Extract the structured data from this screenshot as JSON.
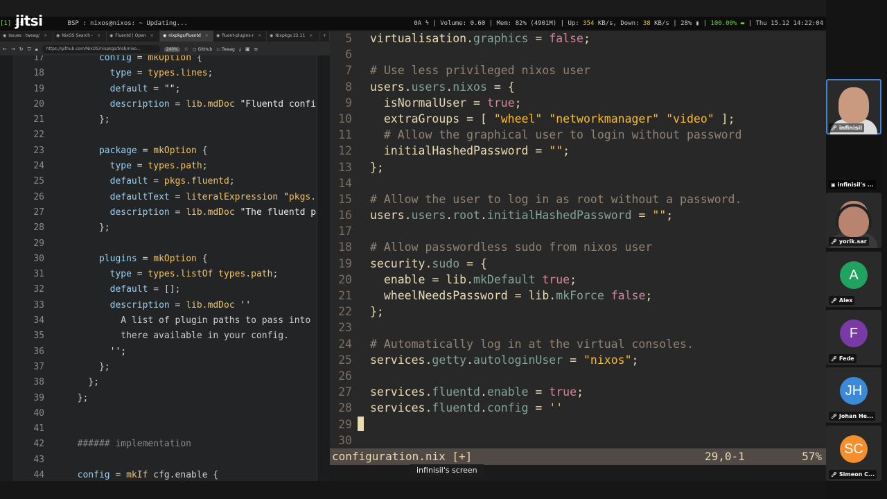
{
  "statusbar": {
    "workspace": "[1] 2:",
    "title": "BSP : nixos@nixos: ~ Updating...",
    "sys_prefix": "0A ϟ | Volume: 0.60 | Mem: 82% (4901M) | Up:",
    "up": "354",
    "sys_mid1": "KB/s, Down:",
    "down": "38",
    "sys_mid2": "KB/s | 28% ▮ |",
    "battery": "100.00%",
    "sys_suffix": "| Thu 15.12 14:22:04"
  },
  "jitsi": {
    "logo": "jitsi"
  },
  "browser": {
    "tabs": [
      {
        "label": "Issues · tweag/",
        "active": false
      },
      {
        "label": "NixOS Search -",
        "active": false
      },
      {
        "label": "Fluentd | Open",
        "active": false
      },
      {
        "label": "nixpkgs/fluentd",
        "active": true
      },
      {
        "label": "fluent-plugins-r",
        "active": false
      },
      {
        "label": "Nixpkgs 22.11",
        "active": false
      }
    ],
    "new_tab": "+",
    "url": "https://github.com/NixOS/nixpkgs/blob/nixo...",
    "zoom": "240%",
    "bookmark1": "GitHub",
    "bookmark2": "Tweag"
  },
  "left_code": [
    {
      "n": "17",
      "t": "      config = mkOption {"
    },
    {
      "n": "18",
      "t": "        type = types.lines;"
    },
    {
      "n": "19",
      "t": "        default = \"\";"
    },
    {
      "n": "20",
      "t": "        description = lib.mdDoc \"Fluentd confi"
    },
    {
      "n": "21",
      "t": "      };"
    },
    {
      "n": "22",
      "t": ""
    },
    {
      "n": "23",
      "t": "      package = mkOption {"
    },
    {
      "n": "24",
      "t": "        type = types.path;"
    },
    {
      "n": "25",
      "t": "        default = pkgs.fluentd;"
    },
    {
      "n": "26",
      "t": "        defaultText = literalExpression \"pkgs.f"
    },
    {
      "n": "27",
      "t": "        description = lib.mdDoc \"The fluentd pa"
    },
    {
      "n": "28",
      "t": "      };"
    },
    {
      "n": "29",
      "t": ""
    },
    {
      "n": "30",
      "t": "      plugins = mkOption {"
    },
    {
      "n": "31",
      "t": "        type = types.listOf types.path;"
    },
    {
      "n": "32",
      "t": "        default = [];"
    },
    {
      "n": "33",
      "t": "        description = lib.mdDoc ''"
    },
    {
      "n": "34",
      "t": "          A list of plugin paths to pass into f"
    },
    {
      "n": "35",
      "t": "          there available in your config."
    },
    {
      "n": "36",
      "t": "        '';"
    },
    {
      "n": "37",
      "t": "      };"
    },
    {
      "n": "38",
      "t": "    };"
    },
    {
      "n": "39",
      "t": "  };"
    },
    {
      "n": "40",
      "t": ""
    },
    {
      "n": "41",
      "t": ""
    },
    {
      "n": "42",
      "t": "  ###### implementation"
    },
    {
      "n": "43",
      "t": ""
    },
    {
      "n": "44",
      "t": "  config = mkIf cfg.enable {"
    }
  ],
  "editor_code": [
    {
      "n": "5",
      "t": "virtualisation.graphics = false;"
    },
    {
      "n": "6",
      "t": ""
    },
    {
      "n": "7",
      "t": "# Use less privileged nixos user"
    },
    {
      "n": "8",
      "t": "users.users.nixos = {"
    },
    {
      "n": "9",
      "t": "  isNormalUser = true;"
    },
    {
      "n": "10",
      "t": "  extraGroups = [ \"wheel\" \"networkmanager\" \"video\" ];"
    },
    {
      "n": "11",
      "t": "  # Allow the graphical user to login without password"
    },
    {
      "n": "12",
      "t": "  initialHashedPassword = \"\";"
    },
    {
      "n": "13",
      "t": "};"
    },
    {
      "n": "14",
      "t": ""
    },
    {
      "n": "15",
      "t": "# Allow the user to log in as root without a password."
    },
    {
      "n": "16",
      "t": "users.users.root.initialHashedPassword = \"\";"
    },
    {
      "n": "17",
      "t": ""
    },
    {
      "n": "18",
      "t": "# Allow passwordless sudo from nixos user"
    },
    {
      "n": "19",
      "t": "security.sudo = {"
    },
    {
      "n": "20",
      "t": "  enable = lib.mkDefault true;"
    },
    {
      "n": "21",
      "t": "  wheelNeedsPassword = lib.mkForce false;"
    },
    {
      "n": "22",
      "t": "};"
    },
    {
      "n": "23",
      "t": ""
    },
    {
      "n": "24",
      "t": "# Automatically log in at the virtual consoles."
    },
    {
      "n": "25",
      "t": "services.getty.autologinUser = \"nixos\";"
    },
    {
      "n": "26",
      "t": ""
    },
    {
      "n": "27",
      "t": "services.fluentd.enable = true;"
    },
    {
      "n": "28",
      "t": "services.fluentd.config = ''"
    },
    {
      "n": "29",
      "t": ""
    },
    {
      "n": "30",
      "t": ""
    }
  ],
  "modeline": {
    "file": "configuration.nix [+]",
    "position": "29,0-1",
    "percent": "57%"
  },
  "screen_label": "infinisil's screen",
  "participants": [
    {
      "name": "infinisil",
      "kind": "video",
      "active": true
    },
    {
      "name": "infinisil's ...",
      "kind": "screen"
    },
    {
      "name": "yorik.sar",
      "kind": "video"
    },
    {
      "name": "Alex",
      "initials": "A",
      "color": "#1fa35f"
    },
    {
      "name": "Fede",
      "initials": "F",
      "color": "#7a3aa6"
    },
    {
      "name": "Johan He...",
      "initials": "JH",
      "color": "#3b8ad8"
    },
    {
      "name": "Simeon C...",
      "initials": "SC",
      "color": "#f58e2c"
    }
  ],
  "colors": {
    "keyword": "#8ec07c",
    "attr": "#83a598",
    "string": "#fabd2f",
    "comment": "#928374",
    "const": "#d3869b",
    "editor_bg": "#282828"
  }
}
